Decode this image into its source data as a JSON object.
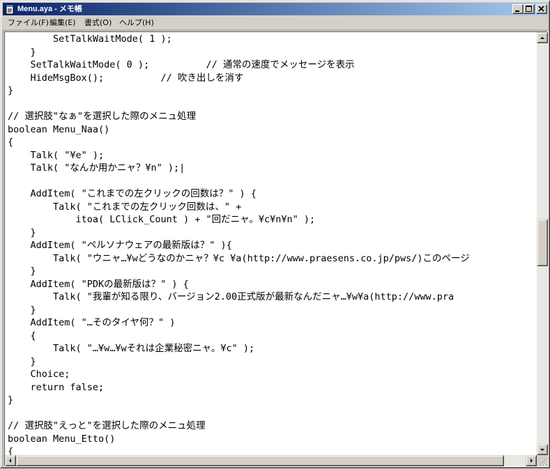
{
  "window": {
    "title": "Menu.aya - メモ帳"
  },
  "menubar": {
    "items": [
      "ファイル(F)",
      "編集(E)",
      "書式(O)",
      "ヘルプ(H)"
    ]
  },
  "editor": {
    "lines": [
      "        SetTalkWaitMode( 1 );",
      "    }",
      "    SetTalkWaitMode( 0 );          // 通常の速度でメッセージを表示",
      "    HideMsgBox();          // 吹き出しを消す",
      "}",
      "",
      "// 選択肢\"なぁ\"を選択した際のメニュ処理",
      "boolean Menu_Naa()",
      "{",
      "    Talk( \"¥e\" );",
      "    Talk( \"なんか用かニャ？¥n\" );|",
      "",
      "    AddItem( \"これまでの左クリックの回数は？\" ) {",
      "        Talk( \"これまでの左クリック回数は、\" +",
      "            itoa( LClick_Count ) + \"回だニャ。¥c¥n¥n\" );",
      "    }",
      "    AddItem( \"ペルソナウェアの最新版は？\" ){",
      "        Talk( \"ウニャ…¥wどうなのかニャ？¥c ¥a(http://www.praesens.co.jp/pws/)このページ",
      "    }",
      "    AddItem( \"PDKの最新版は？\" ) {",
      "        Talk( \"我輩が知る限り、バージョン2.00正式版が最新なんだニャ…¥w¥a(http://www.pra",
      "    }",
      "    AddItem( \"…そのタイヤ何？\" )",
      "    {",
      "        Talk( \"…¥w…¥wそれは企業秘密ニャ。¥c\" );",
      "    }",
      "    Choice;",
      "    return false;",
      "}",
      "",
      "// 選択肢\"えっと\"を選択した際のメニュ処理",
      "boolean Menu_Etto()",
      "{"
    ]
  },
  "icons": {
    "app": "notepad-icon",
    "minimize": "minimize-icon",
    "maximize": "maximize-icon",
    "close": "close-icon"
  }
}
